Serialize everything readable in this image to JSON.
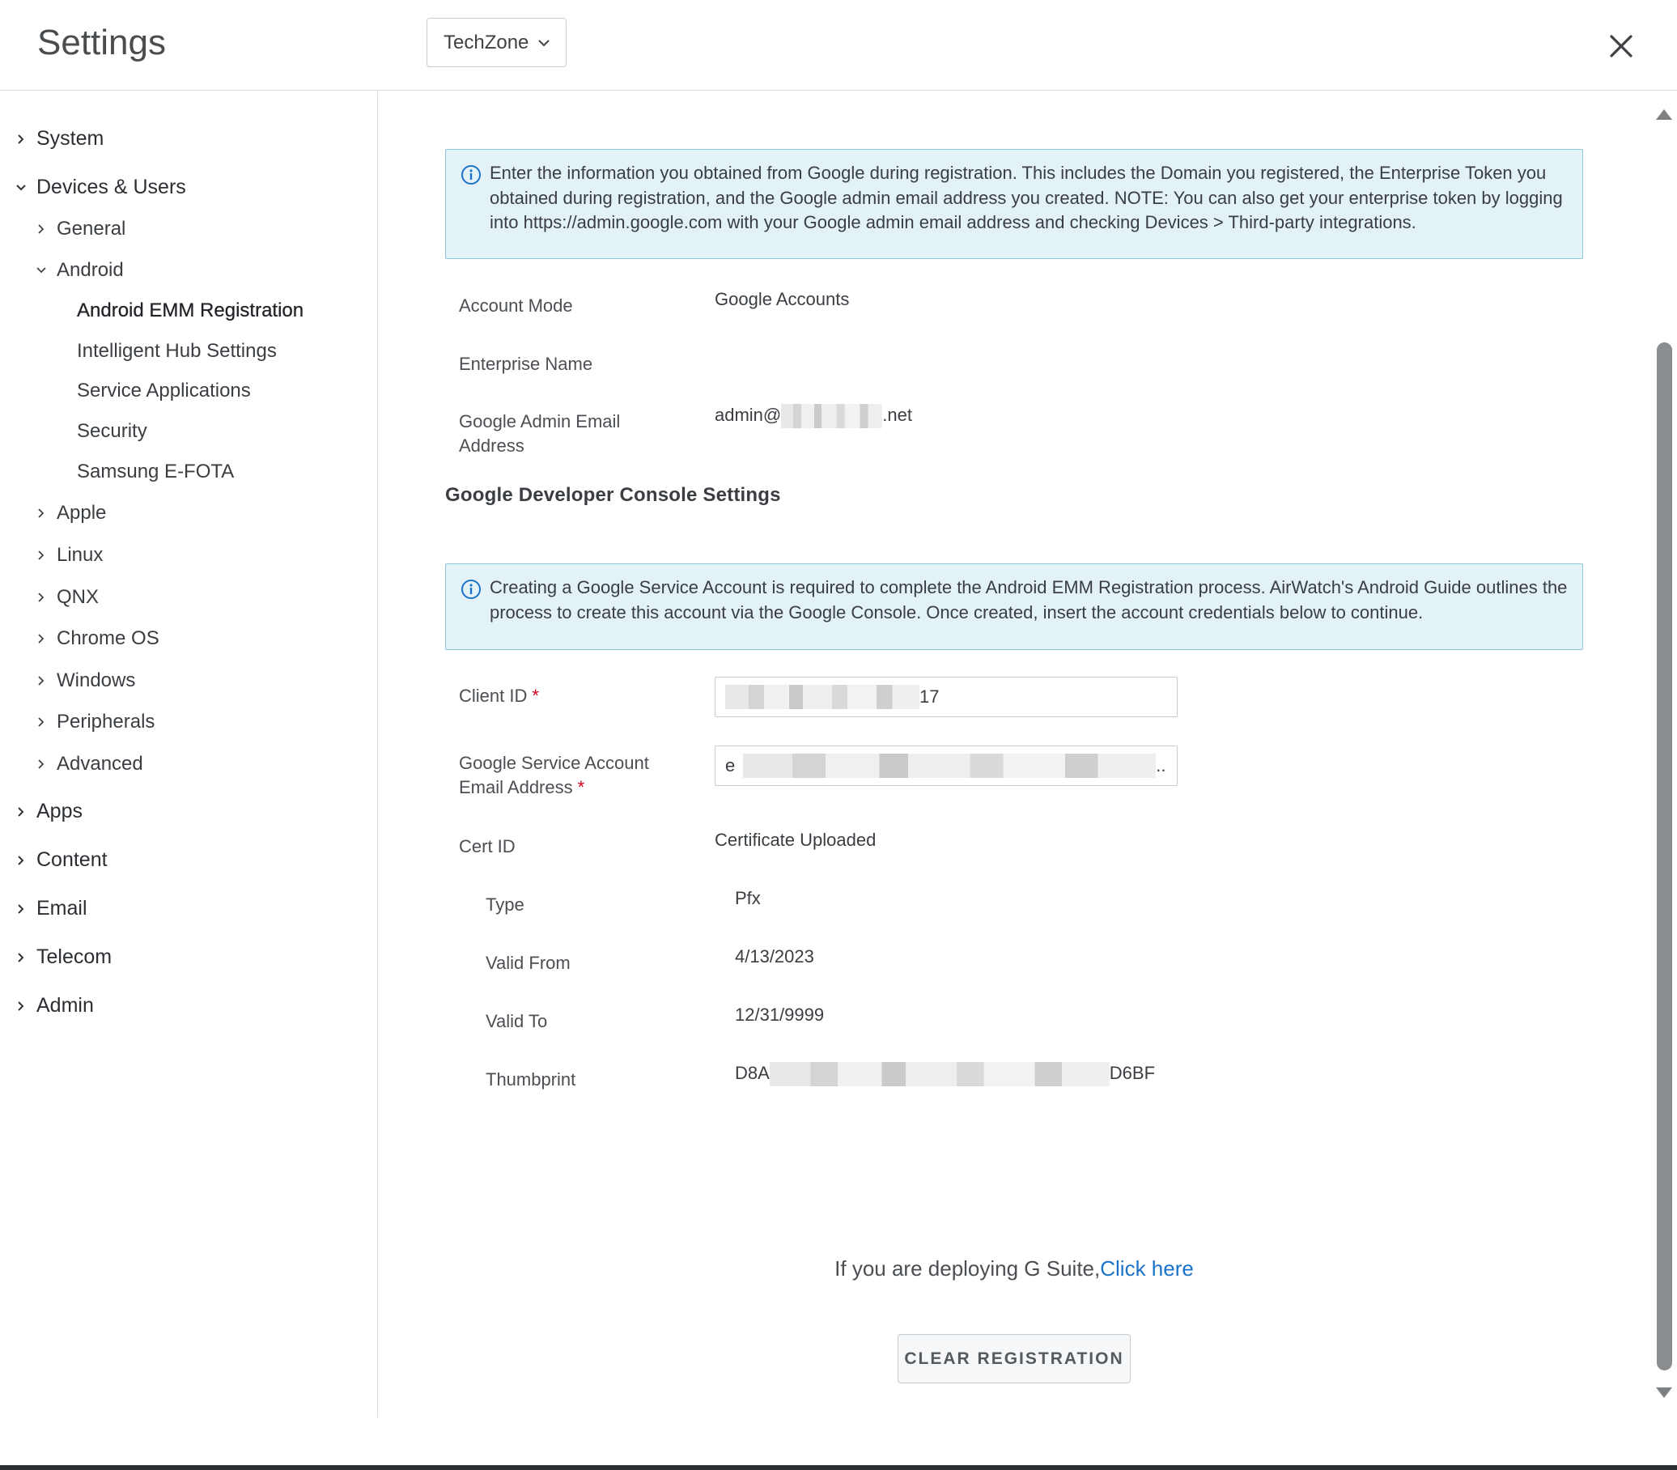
{
  "header": {
    "title": "Settings",
    "org_selector": "TechZone"
  },
  "sidebar": {
    "system": "System",
    "devices_users": "Devices & Users",
    "general": "General",
    "android": "Android",
    "android_emm": "Android EMM Registration",
    "intelligent_hub": "Intelligent Hub Settings",
    "service_apps": "Service Applications",
    "security": "Security",
    "samsung_efota": "Samsung E-FOTA",
    "apple": "Apple",
    "linux": "Linux",
    "qnx": "QNX",
    "chrome_os": "Chrome OS",
    "windows": "Windows",
    "peripherals": "Peripherals",
    "advanced": "Advanced",
    "apps": "Apps",
    "content": "Content",
    "email": "Email",
    "telecom": "Telecom",
    "admin": "Admin"
  },
  "main": {
    "info1": "Enter the information you obtained from Google during registration. This includes the Domain you registered, the Enterprise Token you obtained during registration, and the Google admin email address you created. NOTE: You can also get your enterprise token by logging into https://admin.google.com with your Google admin email address and checking Devices > Third-party integrations.",
    "account_mode_label": "Account Mode",
    "account_mode_value": "Google Accounts",
    "enterprise_name_label": "Enterprise Name",
    "enterprise_name_value": "",
    "admin_email_label": "Google Admin Email Address",
    "admin_email_prefix": "admin@",
    "admin_email_suffix": ".net",
    "dev_console_title": "Google Developer Console Settings",
    "info2": "Creating a Google Service Account is required to complete the Android EMM Registration process. AirWatch's Android Guide outlines the process to create this account via the Google Console. Once created, insert the account credentials below to continue.",
    "client_id_label": "Client ID",
    "client_id_suffix": "17",
    "service_email_label": "Google Service Account Email Address",
    "service_email_prefix": "e",
    "service_email_suffix": "..",
    "required_mark": "*",
    "cert_id_label": "Cert ID",
    "cert_id_value": "Certificate Uploaded",
    "type_label": "Type",
    "type_value": "Pfx",
    "valid_from_label": "Valid From",
    "valid_from_value": "4/13/2023",
    "valid_to_label": "Valid To",
    "valid_to_value": "12/31/9999",
    "thumbprint_label": "Thumbprint",
    "thumbprint_prefix": "D8A",
    "thumbprint_suffix": "D6BF",
    "gsuite_text": "If you are deploying G Suite,",
    "gsuite_link": "Click here",
    "clear_button": "CLEAR REGISTRATION"
  },
  "colors": {
    "info_bg": "#e3f2f7",
    "info_border": "#8fc6d8",
    "link": "#1a73c8",
    "required": "#d0021b"
  },
  "icons": [
    "chevron-down-icon",
    "close-icon",
    "chevron-right-icon",
    "info-icon",
    "scroll-up-icon",
    "scroll-down-icon"
  ]
}
